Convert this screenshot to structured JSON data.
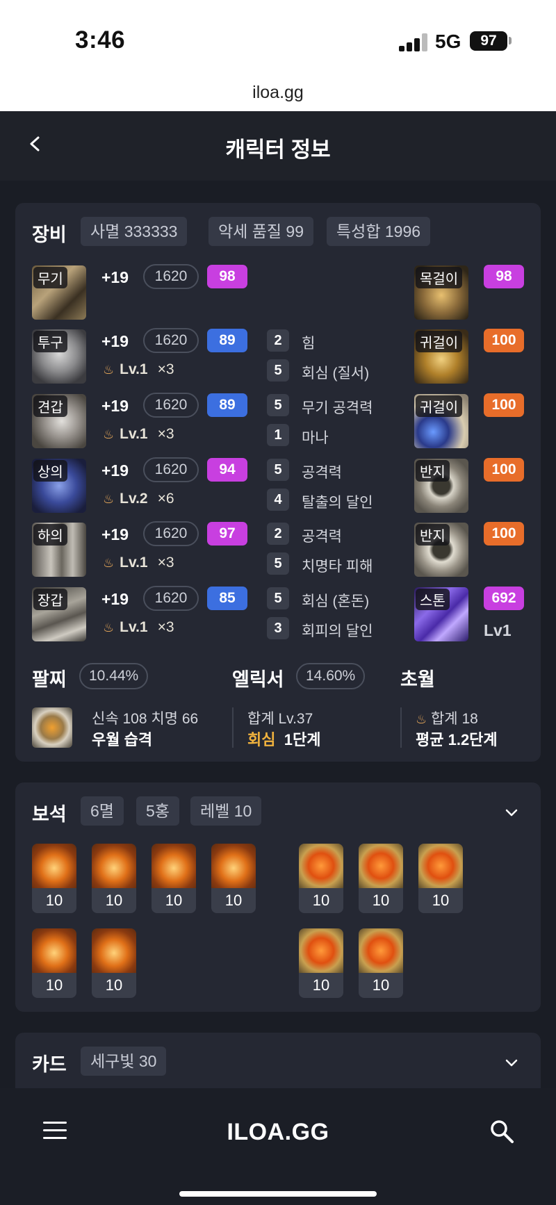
{
  "status": {
    "time": "3:46",
    "network": "5G",
    "battery": "97"
  },
  "browser": {
    "url": "iloa.gg"
  },
  "header": {
    "title": "캐릭터 정보"
  },
  "equipment": {
    "title": "장비",
    "chips": [
      "사멸 333333",
      "악세 품질 99",
      "특성합 1996"
    ],
    "armor": [
      {
        "slot": "무기",
        "plus": "+19",
        "ilvl": "1620",
        "quality": "98",
        "qcolor": "purple",
        "elixir": "",
        "mult": ""
      },
      {
        "slot": "투구",
        "plus": "+19",
        "ilvl": "1620",
        "quality": "89",
        "qcolor": "blue",
        "elixir": "Lv.1",
        "mult": "×3"
      },
      {
        "slot": "견갑",
        "plus": "+19",
        "ilvl": "1620",
        "quality": "89",
        "qcolor": "blue",
        "elixir": "Lv.1",
        "mult": "×3"
      },
      {
        "slot": "상의",
        "plus": "+19",
        "ilvl": "1620",
        "quality": "94",
        "qcolor": "purple",
        "elixir": "Lv.2",
        "mult": "×6"
      },
      {
        "slot": "하의",
        "plus": "+19",
        "ilvl": "1620",
        "quality": "97",
        "qcolor": "purple",
        "elixir": "Lv.1",
        "mult": "×3"
      },
      {
        "slot": "장갑",
        "plus": "+19",
        "ilvl": "1620",
        "quality": "85",
        "qcolor": "blue",
        "elixir": "Lv.1",
        "mult": "×3"
      }
    ],
    "engravings": [
      {
        "num": "2",
        "name": "힘"
      },
      {
        "num": "5",
        "name": "회심 (질서)"
      },
      {
        "num": "5",
        "name": "무기 공격력"
      },
      {
        "num": "1",
        "name": "마나"
      },
      {
        "num": "5",
        "name": "공격력"
      },
      {
        "num": "4",
        "name": "탈출의 달인"
      },
      {
        "num": "2",
        "name": "공격력"
      },
      {
        "num": "5",
        "name": "치명타 피해"
      },
      {
        "num": "5",
        "name": "회심 (혼돈)"
      },
      {
        "num": "3",
        "name": "회피의 달인"
      }
    ],
    "accessories": [
      {
        "slot": "목걸이",
        "quality": "98",
        "qcolor": "purple"
      },
      {
        "slot": "귀걸이",
        "quality": "100",
        "qcolor": "orange"
      },
      {
        "slot": "귀걸이",
        "quality": "100",
        "qcolor": "orange"
      },
      {
        "slot": "반지",
        "quality": "100",
        "qcolor": "orange"
      },
      {
        "slot": "반지",
        "quality": "100",
        "qcolor": "orange"
      },
      {
        "slot": "스톤",
        "quality": "692",
        "qcolor": "purple",
        "level": "Lv1"
      }
    ],
    "bracelet": {
      "title": "팔찌",
      "percent": "10.44%",
      "stats": "신속 108  치명 66",
      "effects": "우월   습격"
    },
    "elixir": {
      "title": "엘릭서",
      "percent": "14.60%",
      "total": "합계 Lv.37",
      "name": "회심",
      "stage": "1단계"
    },
    "transcend": {
      "title": "초월",
      "total": "합계 18",
      "avg": "평균 1.2단계"
    }
  },
  "gems": {
    "title": "보석",
    "chips": [
      "6멸",
      "5홍",
      "레벨 10"
    ],
    "levels": [
      "10",
      "10",
      "10",
      "10",
      "10",
      "10",
      "10",
      "10",
      "10",
      "10",
      "10"
    ]
  },
  "cards": {
    "title": "카드",
    "chip": "세구빛 30"
  },
  "bottom": {
    "brand": "ILOA.GG"
  },
  "colors": {
    "purple": "#c83fe0",
    "blue": "#3c6fe0",
    "orange": "#e86d2a",
    "background": "#1a1d25",
    "card": "#252833"
  }
}
